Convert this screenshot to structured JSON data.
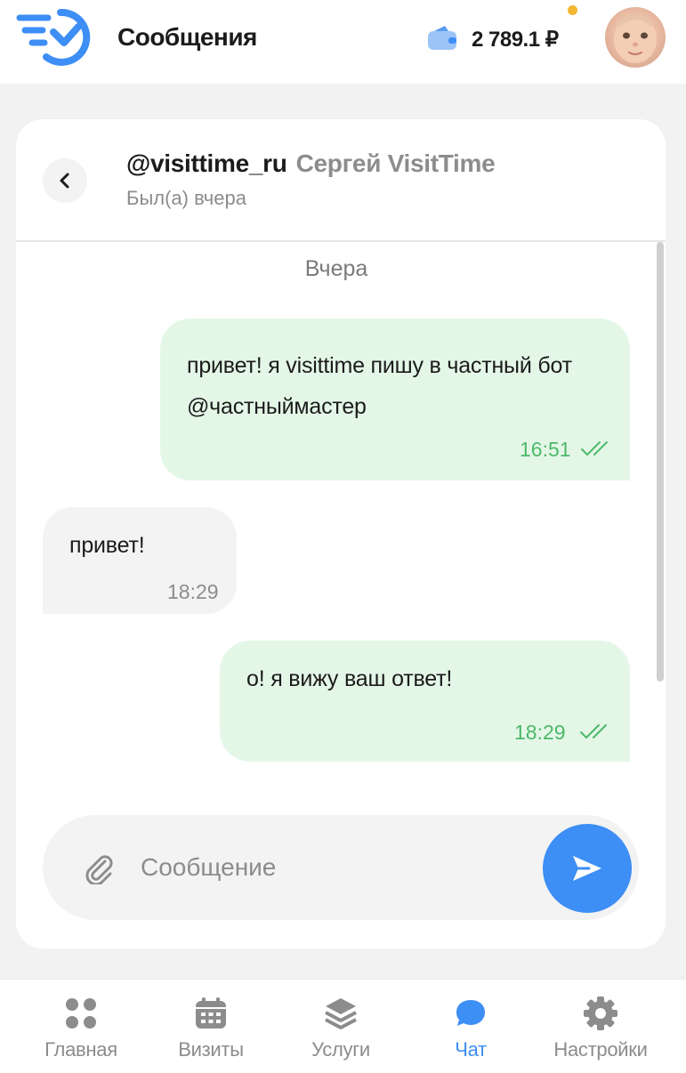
{
  "header": {
    "title": "Сообщения",
    "balance": "2 789.1 ₽",
    "wallet_icon": "wallet-icon",
    "has_notification": true,
    "accent_color": "#3d8ef5"
  },
  "chat": {
    "username": "@visittime_ru",
    "display_name": "Сергей VisitTime",
    "status": "Был(а) вчера",
    "date_separator": "Вчера",
    "messages": [
      {
        "direction": "out",
        "text": "привет! я visittime пишу в частный бот @частныймастер",
        "time": "16:51",
        "read": true
      },
      {
        "direction": "in",
        "text": "привет!",
        "time": "18:29"
      },
      {
        "direction": "out",
        "text": "о! я вижу ваш ответ!",
        "time": "18:29",
        "read": true
      }
    ]
  },
  "composer": {
    "placeholder": "Сообщение",
    "value": ""
  },
  "nav": {
    "items": [
      {
        "label": "Главная",
        "icon": "home-dots-icon",
        "active": false
      },
      {
        "label": "Визиты",
        "icon": "calendar-icon",
        "active": false
      },
      {
        "label": "Услуги",
        "icon": "layers-icon",
        "active": false
      },
      {
        "label": "Чат",
        "icon": "chat-bubble-icon",
        "active": true
      },
      {
        "label": "Настройки",
        "icon": "gear-icon",
        "active": false
      }
    ]
  }
}
